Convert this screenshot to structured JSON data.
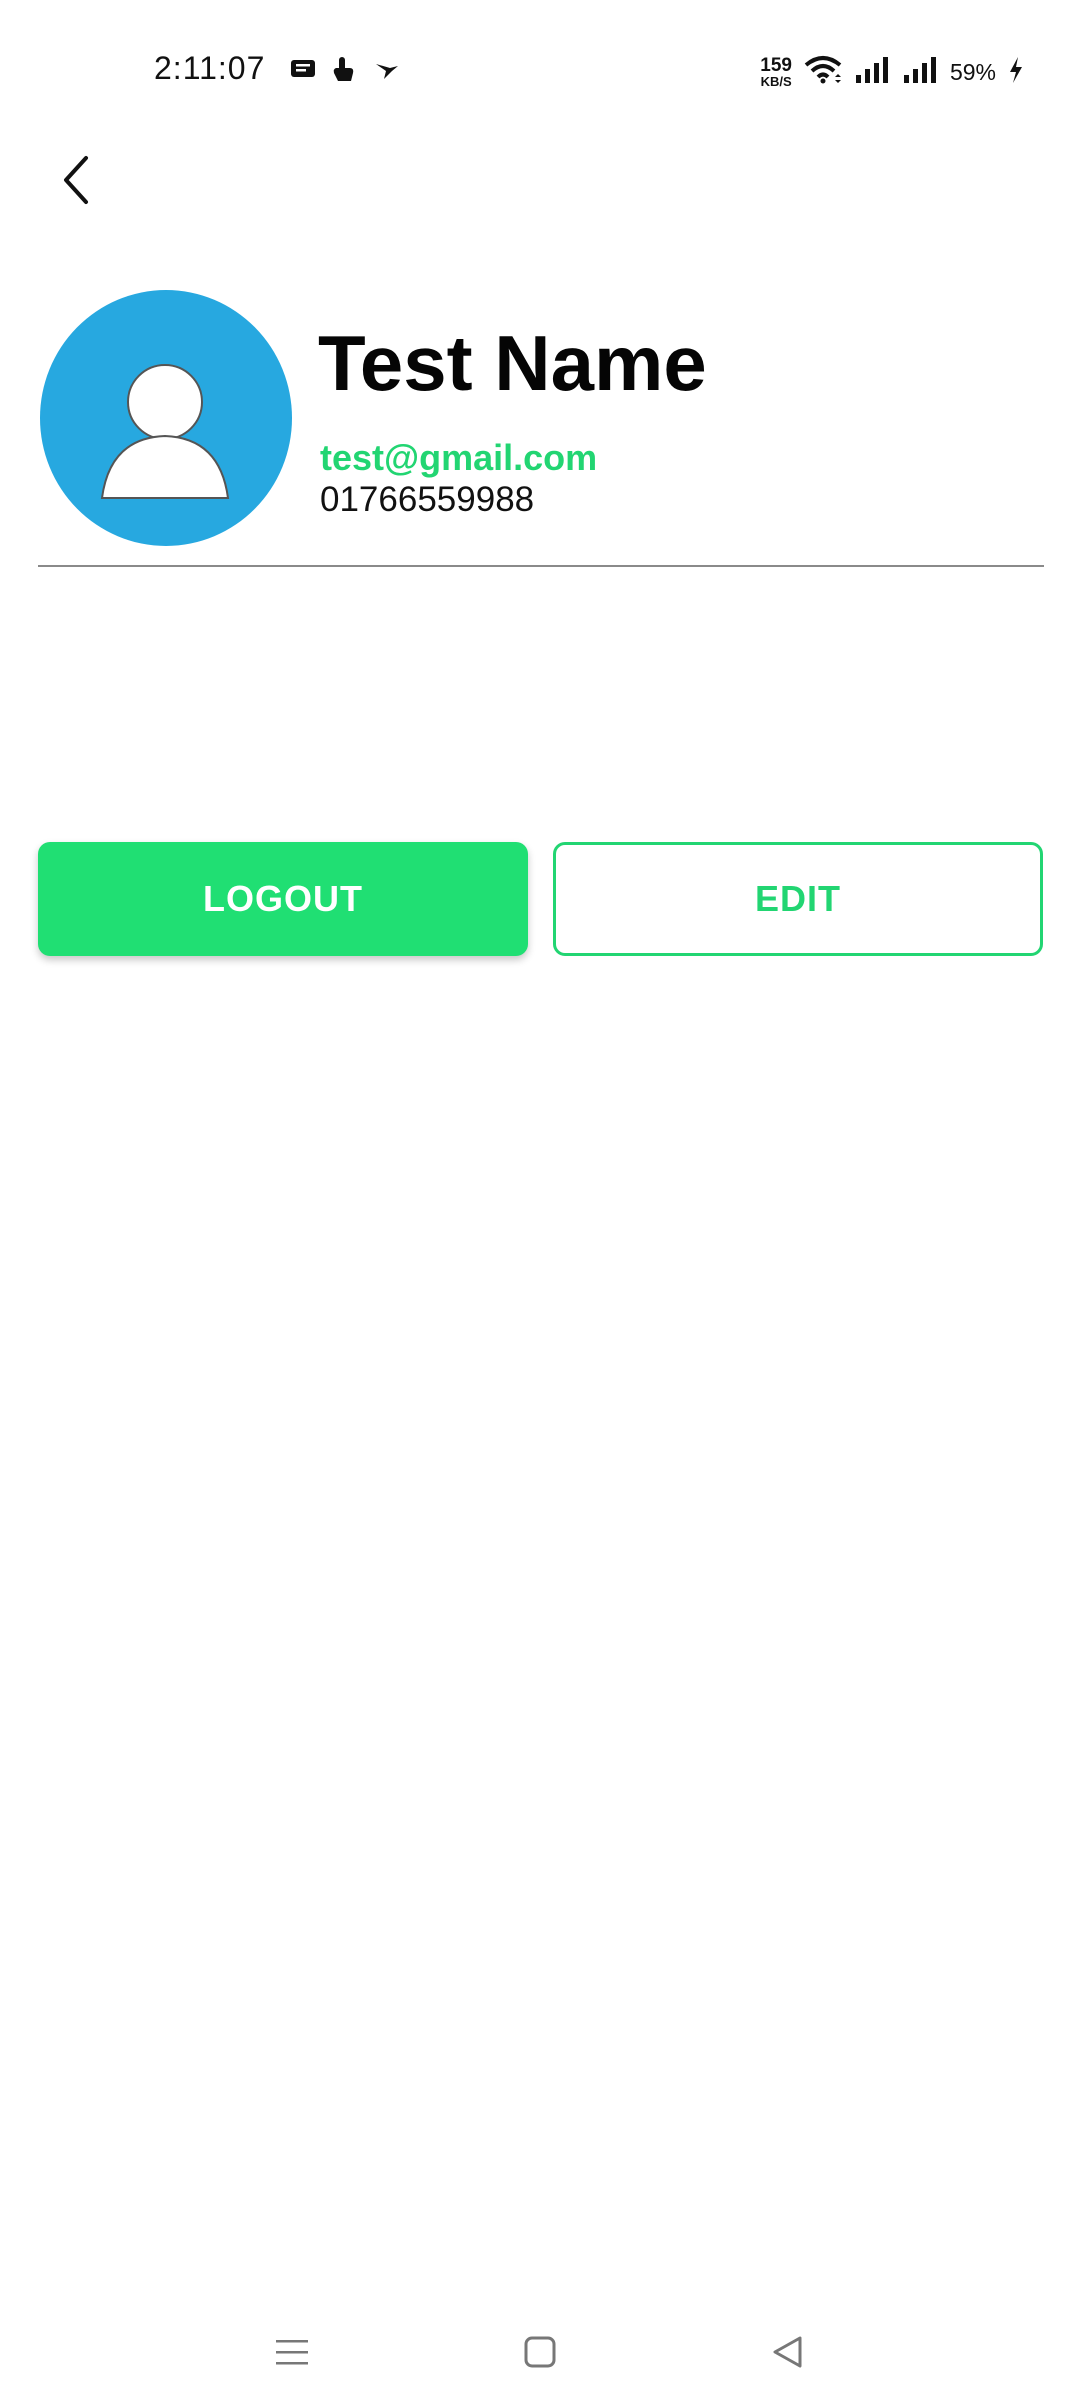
{
  "status_bar": {
    "time": "2:11:07",
    "net_speed_value": "159",
    "net_speed_unit": "KB/S",
    "battery": "59%",
    "icons": [
      "message-icon",
      "touch-icon",
      "bird-icon",
      "wifi-icon",
      "signal-icon",
      "signal-icon",
      "charging-icon"
    ]
  },
  "header": {
    "back_icon": "chevron-left-icon"
  },
  "profile": {
    "avatar_icon": "user-avatar-icon",
    "name": "Test Name",
    "email": "test@gmail.com",
    "phone": "01766559988"
  },
  "actions": {
    "logout_label": "LOGOUT",
    "edit_label": "EDIT"
  },
  "nav_bar": {
    "icons": [
      "menu-icon",
      "home-icon",
      "back-triangle-icon"
    ]
  },
  "colors": {
    "accent_green": "#22d572",
    "avatar_blue": "#27a8e0"
  }
}
